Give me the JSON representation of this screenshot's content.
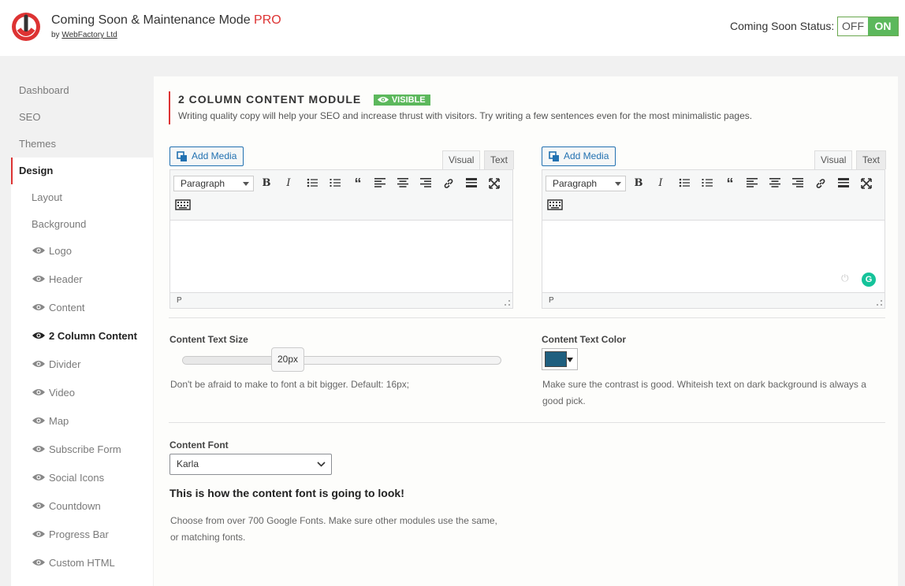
{
  "header": {
    "title": "Coming Soon & Maintenance Mode",
    "title_suffix": "PRO",
    "byline_prefix": "by",
    "byline_link": "WebFactory Ltd",
    "status_label": "Coming Soon Status:",
    "toggle_off": "OFF",
    "toggle_on": "ON"
  },
  "sidebar": {
    "items": [
      {
        "label": "Dashboard"
      },
      {
        "label": "SEO"
      },
      {
        "label": "Themes"
      },
      {
        "label": "Design"
      }
    ],
    "sub_items": [
      {
        "label": "Layout",
        "icon": ""
      },
      {
        "label": "Background",
        "icon": ""
      },
      {
        "label": "Logo",
        "icon": "eye-icon"
      },
      {
        "label": "Header",
        "icon": "eye-icon"
      },
      {
        "label": "Content",
        "icon": "eye-icon"
      },
      {
        "label": "2 Column Content",
        "icon": "eye-icon"
      },
      {
        "label": "Divider",
        "icon": "eye-icon"
      },
      {
        "label": "Video",
        "icon": "eye-icon"
      },
      {
        "label": "Map",
        "icon": "eye-icon"
      },
      {
        "label": "Subscribe Form",
        "icon": "eye-icon"
      },
      {
        "label": "Social Icons",
        "icon": "eye-icon"
      },
      {
        "label": "Countdown",
        "icon": "eye-icon"
      },
      {
        "label": "Progress Bar",
        "icon": "eye-icon"
      },
      {
        "label": "Custom HTML",
        "icon": "eye-icon"
      }
    ]
  },
  "module": {
    "title": "2 COLUMN CONTENT MODULE",
    "badge": "VISIBLE",
    "description": "Writing quality copy will help your SEO and increase thrust with visitors. Try writing a few sentences even for the most minimalistic pages."
  },
  "editors": {
    "add_media": "Add Media",
    "tab_visual": "Visual",
    "tab_text": "Text",
    "format": "Paragraph",
    "status_path": "P"
  },
  "text_size": {
    "label": "Content Text Size",
    "value": "20px",
    "hint": "Don't be afraid to make to font a bit bigger. Default: 16px;"
  },
  "text_color": {
    "label": "Content Text Color",
    "swatch": "#1f5f7f",
    "hint_line1": "Make sure the contrast is good. Whiteish text on dark background is always a",
    "hint_line2": "good pick."
  },
  "font": {
    "label": "Content Font",
    "value": "Karla",
    "preview": "This is how the content font is going to look!",
    "hint_line1": "Choose from over 700 Google Fonts. Make sure other modules use the same,",
    "hint_line2": "or matching fonts."
  },
  "colors": {
    "accent": "#dd3333",
    "success": "#5cb85c",
    "link": "#2271b1"
  }
}
